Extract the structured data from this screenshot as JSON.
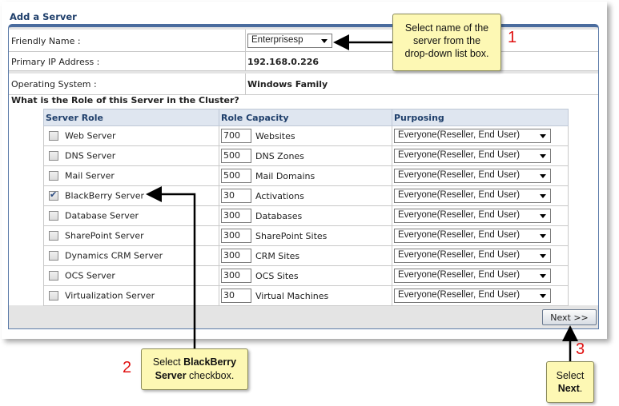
{
  "title": "Add a Server",
  "form": {
    "friendly_name_label": "Friendly Name :",
    "friendly_name_value": "Enterprisesp",
    "ip_label": "Primary IP Address :",
    "ip_value": "192.168.0.226",
    "os_label": "Operating System :",
    "os_value": "Windows Family",
    "role_question": "What is the Role of this Server in the Cluster?"
  },
  "table": {
    "headers": [
      "Server Role",
      "Role Capacity",
      "Purposing"
    ],
    "rows": [
      {
        "role": "Web Server",
        "checked": false,
        "capacity": "700",
        "unit": "Websites",
        "purposing": "Everyone(Reseller, End User)"
      },
      {
        "role": "DNS Server",
        "checked": false,
        "capacity": "500",
        "unit": "DNS Zones",
        "purposing": "Everyone(Reseller, End User)"
      },
      {
        "role": "Mail Server",
        "checked": false,
        "capacity": "500",
        "unit": "Mail Domains",
        "purposing": "Everyone(Reseller, End User)"
      },
      {
        "role": "BlackBerry Server",
        "checked": true,
        "capacity": "30",
        "unit": "Activations",
        "purposing": "Everyone(Reseller, End User)"
      },
      {
        "role": "Database Server",
        "checked": false,
        "capacity": "300",
        "unit": "Databases",
        "purposing": "Everyone(Reseller, End User)"
      },
      {
        "role": "SharePoint Server",
        "checked": false,
        "capacity": "300",
        "unit": "SharePoint Sites",
        "purposing": "Everyone(Reseller, End User)"
      },
      {
        "role": "Dynamics CRM Server",
        "checked": false,
        "capacity": "300",
        "unit": "CRM Sites",
        "purposing": "Everyone(Reseller, End User)"
      },
      {
        "role": "OCS Server",
        "checked": false,
        "capacity": "300",
        "unit": "OCS Sites",
        "purposing": "Everyone(Reseller, End User)"
      },
      {
        "role": "Virtualization Server",
        "checked": false,
        "capacity": "30",
        "unit": "Virtual Machines",
        "purposing": "Everyone(Reseller, End User)"
      }
    ]
  },
  "next_label": "Next >>",
  "callouts": {
    "c1": {
      "num": "1",
      "line1": "Select name of the",
      "line2": "server from the",
      "line3": "drop-down list box."
    },
    "c2": {
      "num": "2",
      "pre": "Select ",
      "bold1": "BlackBerry",
      "bold2": "Server",
      "post": " checkbox."
    },
    "c3": {
      "num": "3",
      "line1": "Select",
      "bold": "Next",
      "post": "."
    }
  },
  "colors": {
    "accent": "#4a6c9e",
    "callout_bg": "#fdf8b4",
    "step_number": "#e01010"
  }
}
